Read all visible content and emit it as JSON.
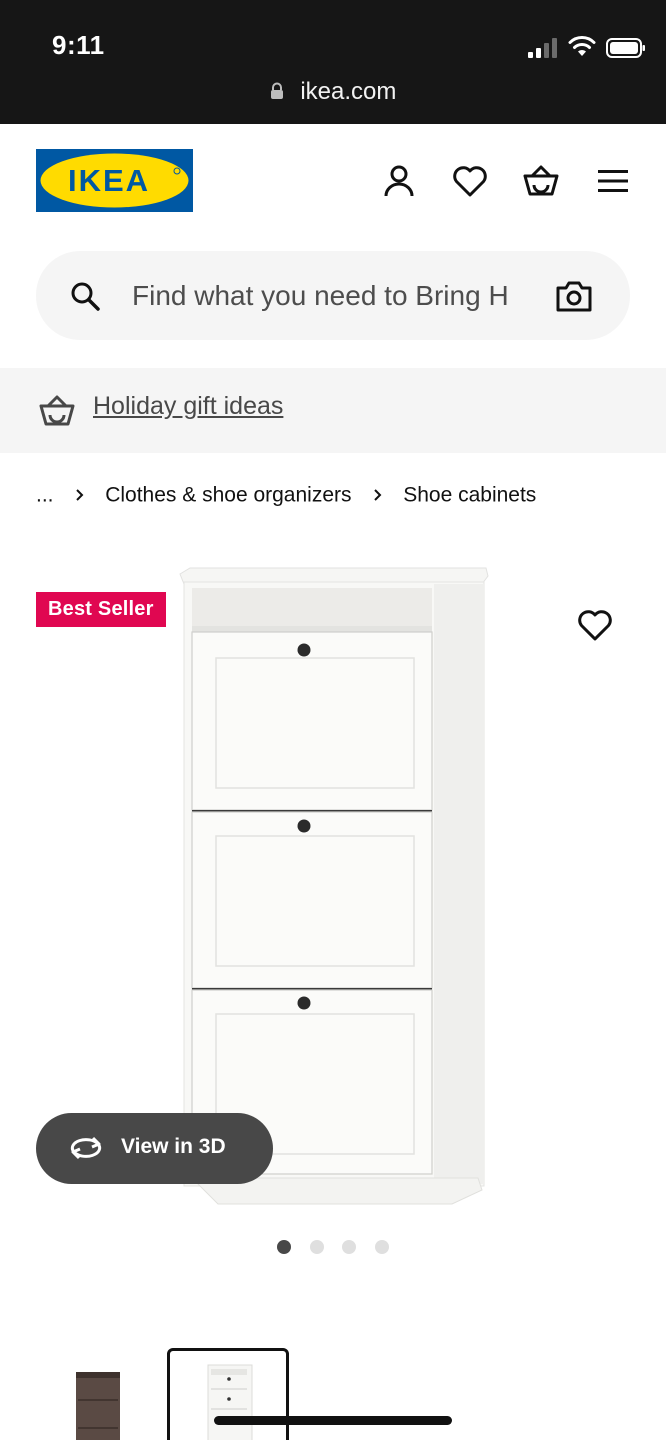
{
  "status": {
    "time": "9:11",
    "url": "ikea.com"
  },
  "header": {
    "logo_text": "IKEA",
    "colors": {
      "logo_blue": "#0058a3",
      "logo_yellow": "#ffdb00",
      "badge": "#e00751"
    },
    "icons": [
      "user-icon",
      "heart-icon",
      "shopping-bag-icon",
      "hamburger-menu-icon"
    ]
  },
  "search": {
    "placeholder": "Find what you need to Bring H"
  },
  "promo": {
    "label": "Holiday gift ideas"
  },
  "breadcrumb": {
    "ellipsis": "...",
    "items": [
      "Clothes & shoe organizers",
      "Shoe cabinets"
    ]
  },
  "product": {
    "badge": "Best Seller",
    "view3d_label": "View in 3D"
  },
  "gallery": {
    "dots": 4,
    "active_dot": 0
  }
}
